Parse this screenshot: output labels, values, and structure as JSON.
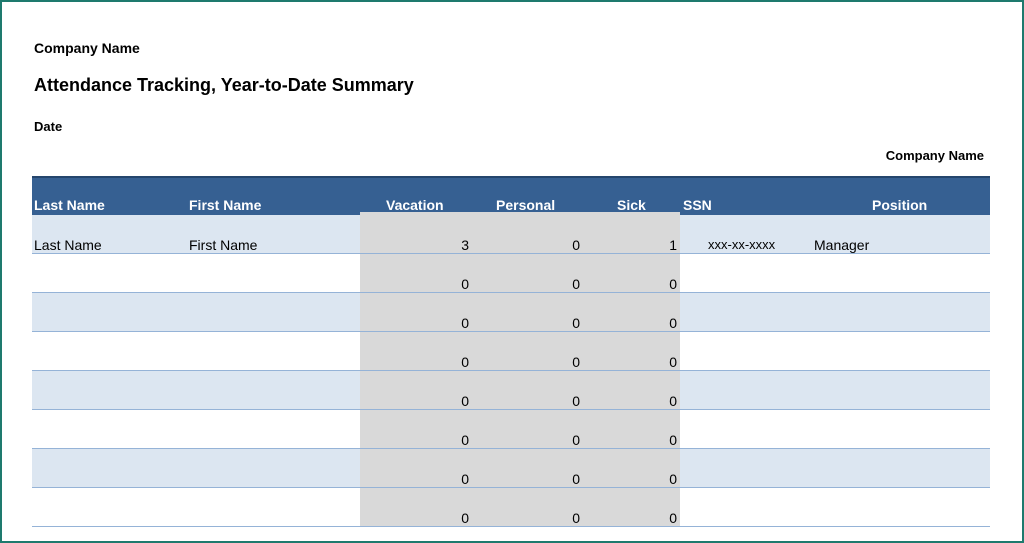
{
  "company_name": "Company Name",
  "report_title": "Attendance Tracking, Year-to-Date Summary",
  "date_label": "Date",
  "company_name_right": "Company Name",
  "columns": {
    "last_name": "Last Name",
    "first_name": "First Name",
    "vacation": "Vacation",
    "personal": "Personal",
    "sick": "Sick",
    "ssn": "SSN",
    "position": "Position"
  },
  "rows": [
    {
      "last_name": "Last Name",
      "first_name": "First Name",
      "vacation": "3",
      "personal": "0",
      "sick": "1",
      "ssn": "xxx-xx-xxxx",
      "position": "Manager"
    },
    {
      "last_name": "",
      "first_name": "",
      "vacation": "0",
      "personal": "0",
      "sick": "0",
      "ssn": "",
      "position": ""
    },
    {
      "last_name": "",
      "first_name": "",
      "vacation": "0",
      "personal": "0",
      "sick": "0",
      "ssn": "",
      "position": ""
    },
    {
      "last_name": "",
      "first_name": "",
      "vacation": "0",
      "personal": "0",
      "sick": "0",
      "ssn": "",
      "position": ""
    },
    {
      "last_name": "",
      "first_name": "",
      "vacation": "0",
      "personal": "0",
      "sick": "0",
      "ssn": "",
      "position": ""
    },
    {
      "last_name": "",
      "first_name": "",
      "vacation": "0",
      "personal": "0",
      "sick": "0",
      "ssn": "",
      "position": ""
    },
    {
      "last_name": "",
      "first_name": "",
      "vacation": "0",
      "personal": "0",
      "sick": "0",
      "ssn": "",
      "position": ""
    },
    {
      "last_name": "",
      "first_name": "",
      "vacation": "0",
      "personal": "0",
      "sick": "0",
      "ssn": "",
      "position": ""
    }
  ],
  "colors": {
    "header_bg": "#366092",
    "band_bg": "#dce6f1",
    "shaded_col": "#d9d9d9",
    "frame_border": "#1e7a6e"
  }
}
